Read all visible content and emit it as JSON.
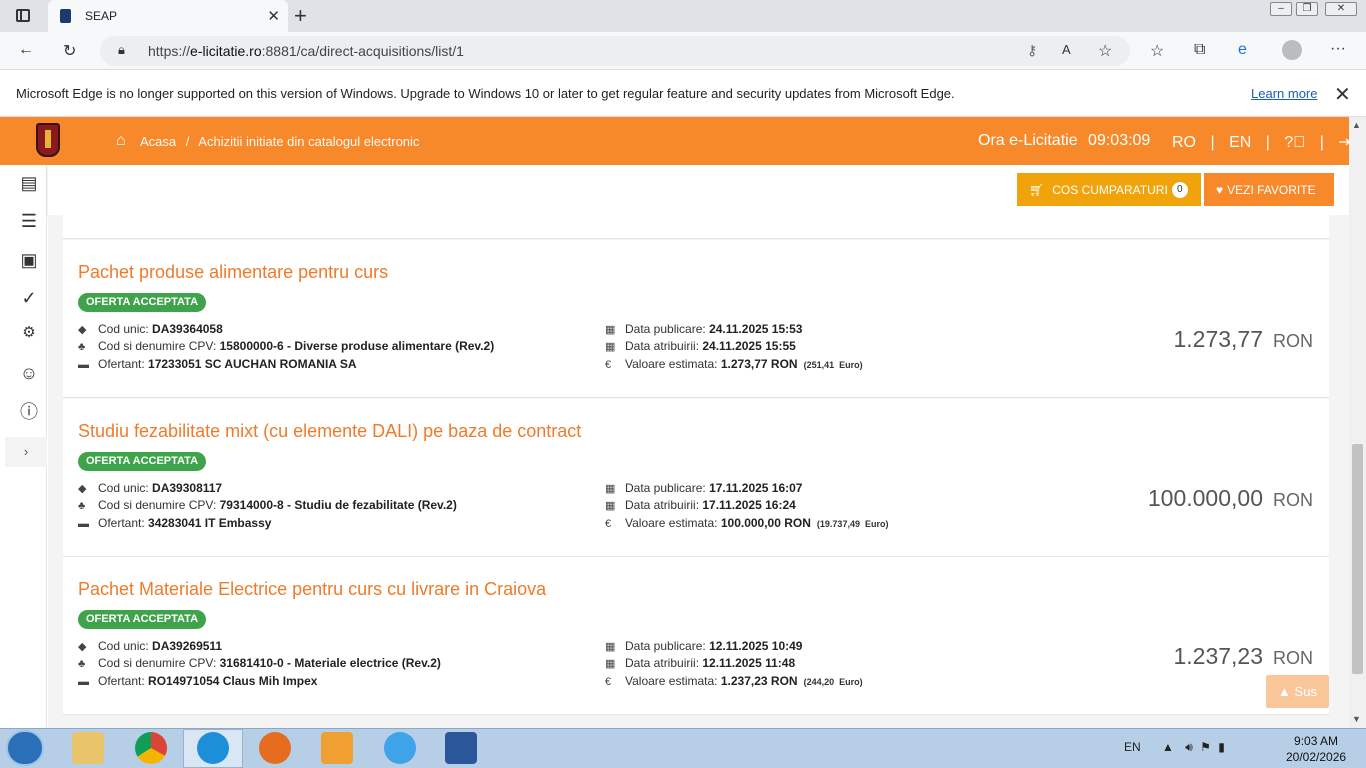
{
  "browser": {
    "tab_title": "SEAP",
    "url_prefix": "https://",
    "url_domain": "e-licitatie.ro",
    "url_path": ":8881/ca/direct-acquisitions/list/1"
  },
  "banner": {
    "text": "Microsoft Edge is no longer supported on this version of Windows. Upgrade to Windows 10 or later to get regular feature and security updates from Microsoft Edge.",
    "learn_more": "Learn more"
  },
  "header": {
    "home": "Acasa",
    "separator": "/",
    "breadcrumb": "Achizitii initiate din catalogul electronic",
    "clock_label": "Ora e-Licitatie",
    "clock_time": "09:03:09",
    "lang_ro": "RO",
    "lang_en": "EN",
    "pipe": "|"
  },
  "toolbar": {
    "cart_label": "COS CUMPARATURI",
    "cart_count": "0",
    "favorites_label": "VEZI FAVORITE"
  },
  "labels": {
    "cod_unic": "Cod unic:",
    "cpv": "Cod si denumire CPV:",
    "ofertant": "Ofertant:",
    "data_publicare": "Data publicare:",
    "data_atribuirii": "Data atribuirii:",
    "valoare": "Valoare estimata:",
    "currency": "RON",
    "euro": "Euro"
  },
  "items": [
    {
      "title": "Pachet produse alimentare pentru curs",
      "status": "OFERTA ACCEPTATA",
      "cod_unic": "DA39364058",
      "cpv": "15800000-6 - Diverse produse alimentare (Rev.2)",
      "ofertant": "17233051 SC AUCHAN ROMANIA SA",
      "data_publicare": "24.11.2025 15:53",
      "data_atribuirii": "24.11.2025 15:55",
      "valoare": "1.273,77",
      "valoare_euro": "(251,41",
      "price": "1.273,77"
    },
    {
      "title": "Studiu fezabilitate mixt (cu elemente DALI) pe baza de contract",
      "status": "OFERTA ACCEPTATA",
      "cod_unic": "DA39308117",
      "cpv": "79314000-8 - Studiu de fezabilitate (Rev.2)",
      "ofertant": "34283041 IT Embassy",
      "data_publicare": "17.11.2025 16:07",
      "data_atribuirii": "17.11.2025 16:24",
      "valoare": "100.000,00",
      "valoare_euro": "(19.737,49",
      "price": "100.000,00"
    },
    {
      "title": "Pachet Materiale Electrice pentru curs cu livrare in Craiova",
      "status": "OFERTA ACCEPTATA",
      "cod_unic": "DA39269511",
      "cpv": "31681410-0 - Materiale electrice (Rev.2)",
      "ofertant": "RO14971054 Claus Mih Impex",
      "data_publicare": "12.11.2025 10:49",
      "data_atribuirii": "12.11.2025 11:48",
      "valoare": "1.237,23",
      "valoare_euro": "(244,20",
      "price": "1.237,23"
    }
  ],
  "scroll_top": "Sus",
  "taskbar": {
    "lang": "EN",
    "time": "9:03 AM",
    "date": "20/02/2026"
  }
}
